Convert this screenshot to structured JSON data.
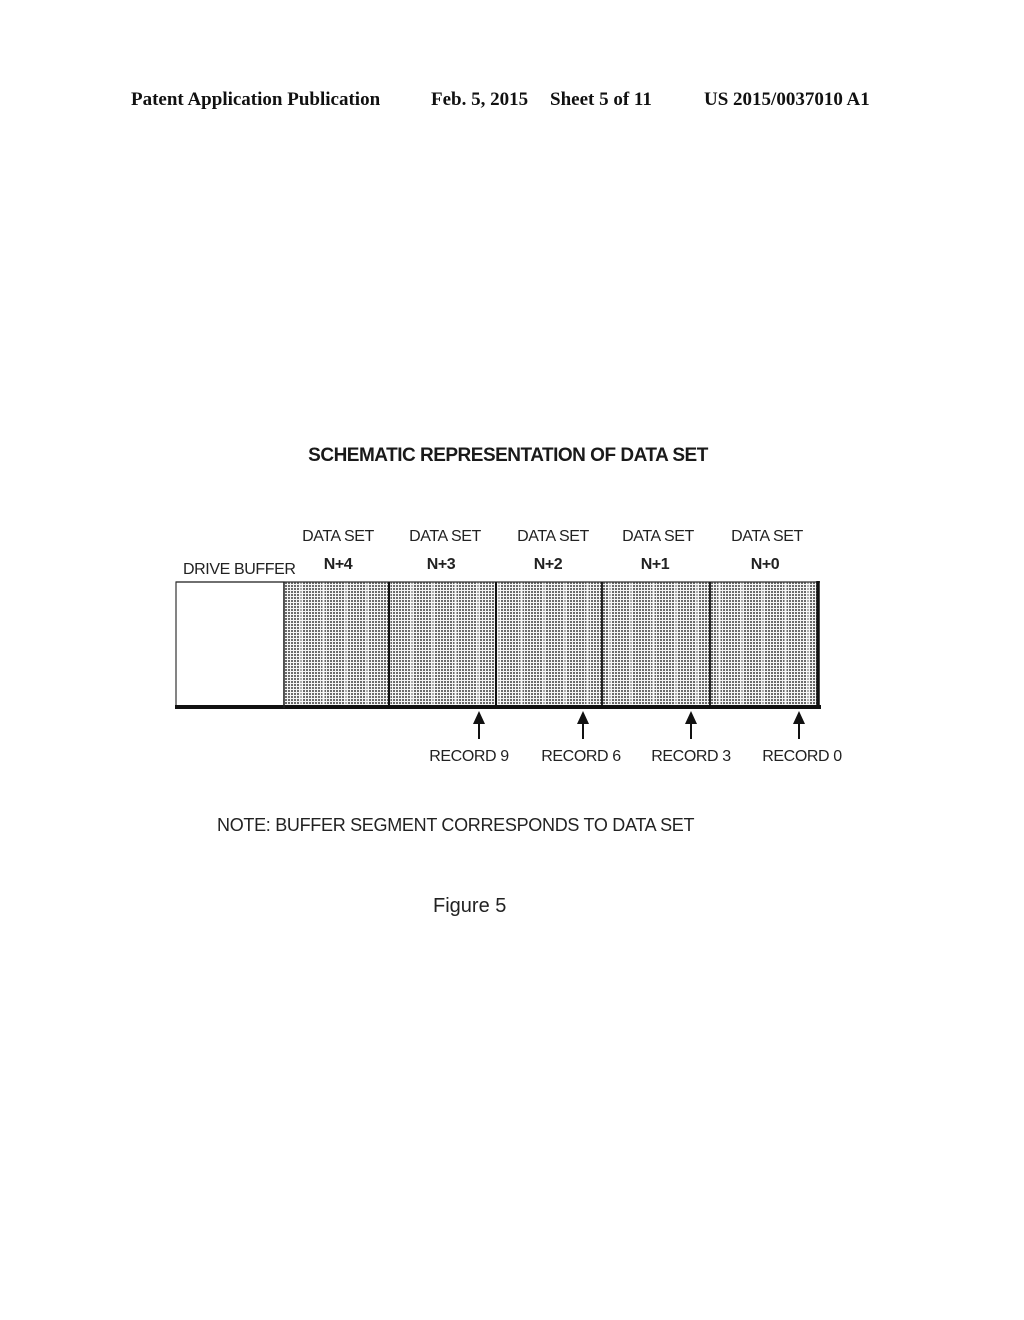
{
  "header": {
    "publication": "Patent Application Publication",
    "date": "Feb. 5, 2015",
    "sheet": "Sheet 5 of 11",
    "number": "US 2015/0037010 A1"
  },
  "figure": {
    "title": "SCHEMATIC REPRESENTATION OF DATA SET",
    "drive_buffer_label": "DRIVE BUFFER",
    "data_sets": [
      {
        "line1": "DATA SET",
        "line2": "N+4"
      },
      {
        "line1": "DATA SET",
        "line2": "N+3"
      },
      {
        "line1": "DATA SET",
        "line2": "N+2"
      },
      {
        "line1": "DATA SET",
        "line2": "N+1"
      },
      {
        "line1": "DATA SET",
        "line2": "N+0"
      }
    ],
    "records": [
      {
        "label": "RECORD 9"
      },
      {
        "label": "RECORD 6"
      },
      {
        "label": "RECORD 3"
      },
      {
        "label": "RECORD 0"
      }
    ],
    "note": "NOTE: BUFFER SEGMENT CORRESPONDS TO DATA SET",
    "caption": "Figure 5"
  }
}
